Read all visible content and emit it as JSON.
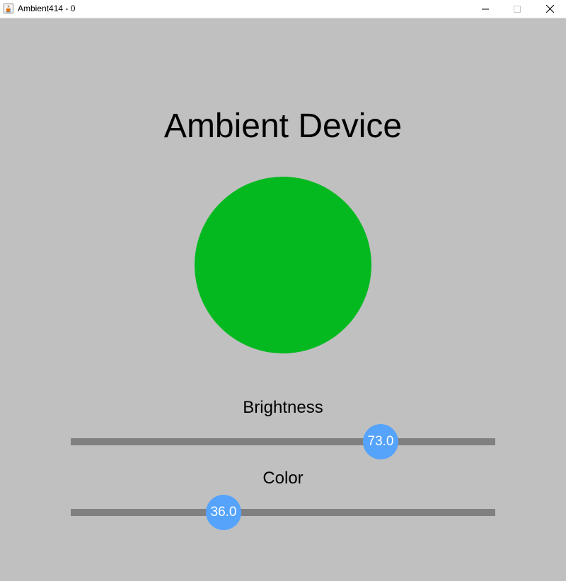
{
  "window": {
    "title": "Ambient414 - 0",
    "icon": "java-cup-icon",
    "controls": [
      "minimize-icon",
      "maximize-icon",
      "close-icon"
    ]
  },
  "heading": "Ambient Device",
  "lamp": {
    "color": "#04b920"
  },
  "brightness": {
    "label": "Brightness",
    "value_text": "73.0",
    "value": 73,
    "min": 0,
    "max": 100
  },
  "color": {
    "label": "Color",
    "value_text": "36.0",
    "value": 36,
    "min": 0,
    "max": 100
  },
  "colors": {
    "background": "#c0c0c0",
    "track": "#808080",
    "thumb": "#55a3fb",
    "thumb_text": "#ffffff"
  }
}
